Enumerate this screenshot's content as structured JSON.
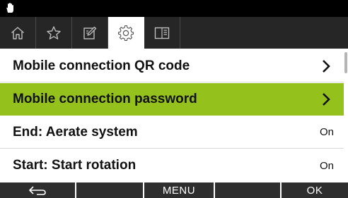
{
  "colors": {
    "status_bar": "#000000",
    "tab_bar": "#262626",
    "selected_row": "#94c11c",
    "softkey_bar": "#2e2e2e"
  },
  "status_bar": {
    "icon": "hand-icon"
  },
  "tabs": [
    {
      "icon": "home-icon",
      "active": false
    },
    {
      "icon": "star-icon",
      "active": false
    },
    {
      "icon": "edit-icon",
      "active": false
    },
    {
      "icon": "gear-icon",
      "active": true
    },
    {
      "icon": "book-icon",
      "active": false
    }
  ],
  "list": {
    "items": [
      {
        "label": "Mobile connection QR code",
        "indicator": "chevron-right-icon",
        "selected": false
      },
      {
        "label": "Mobile connection password",
        "indicator": "chevron-right-icon",
        "selected": true
      },
      {
        "label": "End: Aerate system",
        "value": "On",
        "selected": false
      },
      {
        "label": "Start: Start rotation",
        "value": "On",
        "selected": false
      }
    ]
  },
  "softkeys": [
    {
      "icon": "back-arrow-icon",
      "label": ""
    },
    {
      "label": ""
    },
    {
      "label": "MENU"
    },
    {
      "label": ""
    },
    {
      "label": "OK"
    }
  ]
}
